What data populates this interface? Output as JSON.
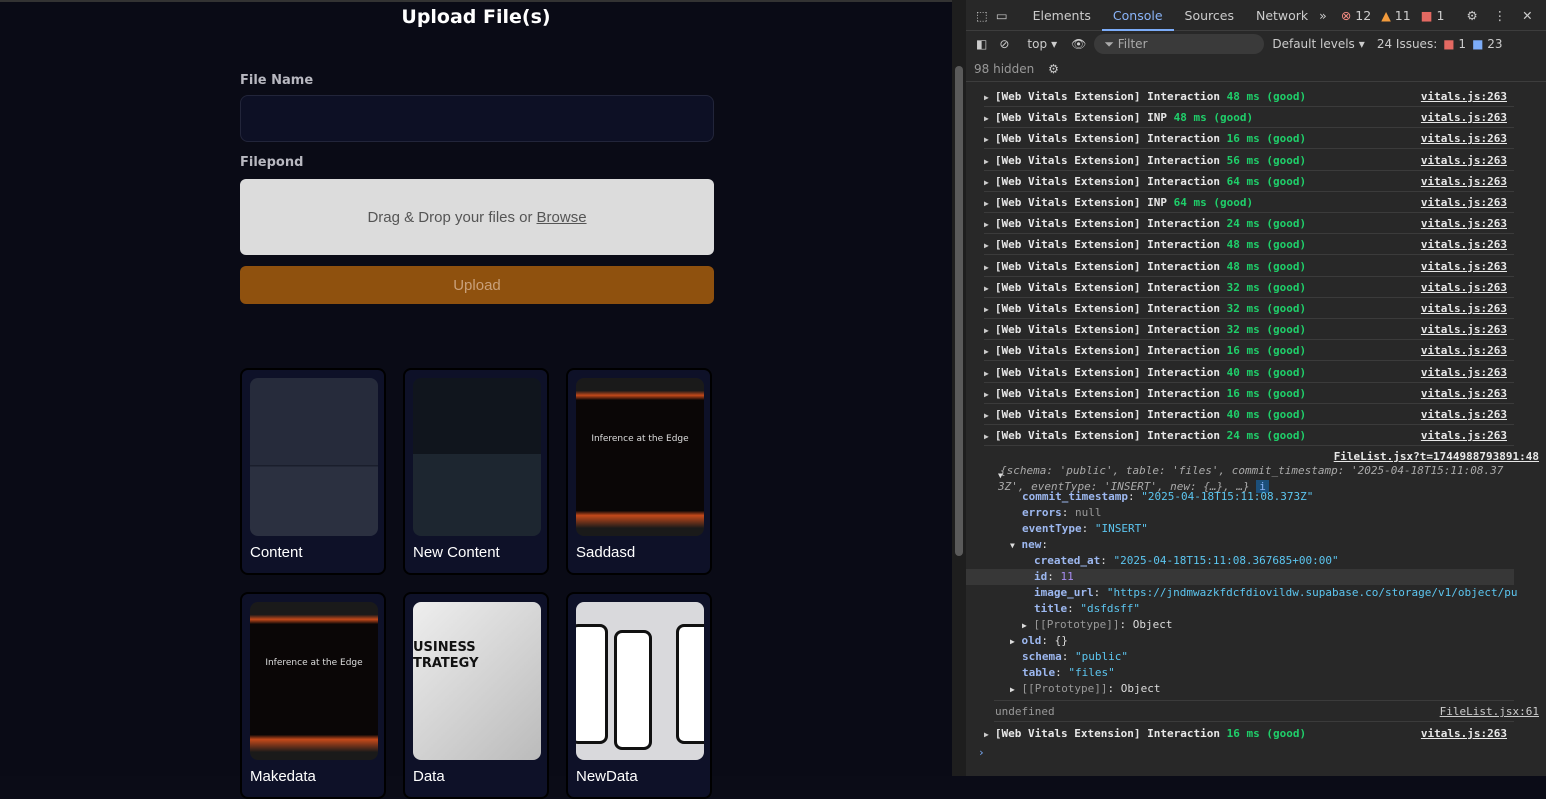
{
  "app": {
    "title": "Upload File(s)",
    "file_name_label": "File Name",
    "file_name_value": "",
    "filepond_label": "Filepond",
    "drop_text": "Drag & Drop your files or",
    "browse": "Browse",
    "upload_button": "Upload",
    "cards": [
      {
        "name": "Content"
      },
      {
        "name": "New Content"
      },
      {
        "name": "Saddasd"
      },
      {
        "name": "Makedata"
      },
      {
        "name": "Data"
      },
      {
        "name": "NewData"
      }
    ],
    "thumb_text_inference": "Inference at the Edge",
    "thumb_text_business": "USINESS TRATEGY"
  },
  "devtools": {
    "tabs": [
      "Elements",
      "Console",
      "Sources",
      "Network"
    ],
    "active_tab": "Console",
    "errors": "12",
    "warnings": "11",
    "issues_badge": "1",
    "context": "top",
    "filter_placeholder": "Filter",
    "levels": "Default levels",
    "issues_label": "24 Issues:",
    "issues_err": "1",
    "issues_info": "23",
    "hidden": "98 hidden",
    "logs": [
      {
        "prefix": "[Web Vitals Extension]",
        "type": "Interaction",
        "value": "48 ms (good)",
        "src": "vitals.js:263"
      },
      {
        "prefix": "[Web Vitals Extension]",
        "type": "INP",
        "value": "48 ms (good)",
        "src": "vitals.js:263"
      },
      {
        "prefix": "[Web Vitals Extension]",
        "type": "Interaction",
        "value": "16 ms (good)",
        "src": "vitals.js:263"
      },
      {
        "prefix": "[Web Vitals Extension]",
        "type": "Interaction",
        "value": "56 ms (good)",
        "src": "vitals.js:263"
      },
      {
        "prefix": "[Web Vitals Extension]",
        "type": "Interaction",
        "value": "64 ms (good)",
        "src": "vitals.js:263"
      },
      {
        "prefix": "[Web Vitals Extension]",
        "type": "INP",
        "value": "64 ms (good)",
        "src": "vitals.js:263"
      },
      {
        "prefix": "[Web Vitals Extension]",
        "type": "Interaction",
        "value": "24 ms (good)",
        "src": "vitals.js:263"
      },
      {
        "prefix": "[Web Vitals Extension]",
        "type": "Interaction",
        "value": "48 ms (good)",
        "src": "vitals.js:263"
      },
      {
        "prefix": "[Web Vitals Extension]",
        "type": "Interaction",
        "value": "48 ms (good)",
        "src": "vitals.js:263"
      },
      {
        "prefix": "[Web Vitals Extension]",
        "type": "Interaction",
        "value": "32 ms (good)",
        "src": "vitals.js:263"
      },
      {
        "prefix": "[Web Vitals Extension]",
        "type": "Interaction",
        "value": "32 ms (good)",
        "src": "vitals.js:263"
      },
      {
        "prefix": "[Web Vitals Extension]",
        "type": "Interaction",
        "value": "32 ms (good)",
        "src": "vitals.js:263"
      },
      {
        "prefix": "[Web Vitals Extension]",
        "type": "Interaction",
        "value": "16 ms (good)",
        "src": "vitals.js:263"
      },
      {
        "prefix": "[Web Vitals Extension]",
        "type": "Interaction",
        "value": "40 ms (good)",
        "src": "vitals.js:263"
      },
      {
        "prefix": "[Web Vitals Extension]",
        "type": "Interaction",
        "value": "16 ms (good)",
        "src": "vitals.js:263"
      },
      {
        "prefix": "[Web Vitals Extension]",
        "type": "Interaction",
        "value": "40 ms (good)",
        "src": "vitals.js:263"
      },
      {
        "prefix": "[Web Vitals Extension]",
        "type": "Interaction",
        "value": "24 ms (good)",
        "src": "vitals.js:263"
      }
    ],
    "obj_src": "FileList.jsx?t=1744988793891:48",
    "obj_summary1": "{schema: 'public', table: 'files', commit_timestamp: '2025-04-18T15:11:08.37",
    "obj_summary2": "3Z', eventType: 'INSERT', new: {…}, …}",
    "props": {
      "commit_timestamp": "\"2025-04-18T15:11:08.373Z\"",
      "errors": "null",
      "eventType": "\"INSERT\"",
      "created_at": "\"2025-04-18T15:11:08.367685+00:00\"",
      "id": "11",
      "image_url": "\"https://jndmwazkfdcfdiovildw.supabase.co/storage/v1/object/pu",
      "title": "\"dsfdsff\"",
      "prototype": "Object",
      "old": "{}",
      "schema": "\"public\"",
      "table": "\"files\""
    },
    "undefined": "undefined",
    "undef_src": "FileList.jsx:61",
    "last": {
      "prefix": "[Web Vitals Extension]",
      "type": "Interaction",
      "value": "16 ms (good)",
      "src": "vitals.js:263"
    }
  }
}
